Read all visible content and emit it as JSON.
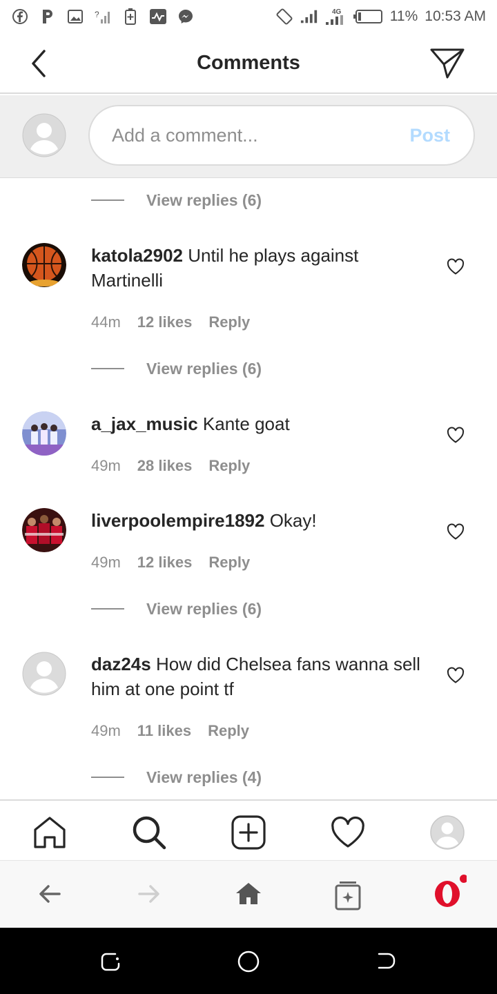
{
  "status_bar": {
    "battery": "11%",
    "time": "10:53 AM",
    "network": "4G",
    "icons": [
      "facebook-icon",
      "p-icon",
      "gallery-icon",
      "signal-unknown-icon",
      "battery-saver-icon",
      "activity-icon",
      "messenger-icon",
      "rotation-icon",
      "signal-icon",
      "signal-4g-icon",
      "battery-icon"
    ]
  },
  "header": {
    "title": "Comments"
  },
  "composer": {
    "placeholder": "Add a comment...",
    "post_label": "Post"
  },
  "comments": [
    {
      "user": "katola2902",
      "text": "Until he plays against Martinelli",
      "time": "44m",
      "likes": "12 likes",
      "reply": "Reply",
      "replies": "View replies (6)"
    },
    {
      "user": "a_jax_music",
      "text": "Kante goat",
      "time": "49m",
      "likes": "28 likes",
      "reply": "Reply"
    },
    {
      "user": "liverpoolempire1892",
      "text": "Okay!",
      "time": "49m",
      "likes": "12 likes",
      "reply": "Reply",
      "replies": "View replies (6)"
    },
    {
      "user": "daz24s",
      "text": "How did Chelsea fans wanna sell him at one point tf",
      "time": "49m",
      "likes": "11 likes",
      "reply": "Reply",
      "replies": "View replies (4)"
    }
  ],
  "top_replies": "View replies (6)",
  "colors": {
    "accent_disabled": "#b3dbff",
    "secondary_text": "#8e8e8e",
    "opera_red": "#e0102b"
  }
}
